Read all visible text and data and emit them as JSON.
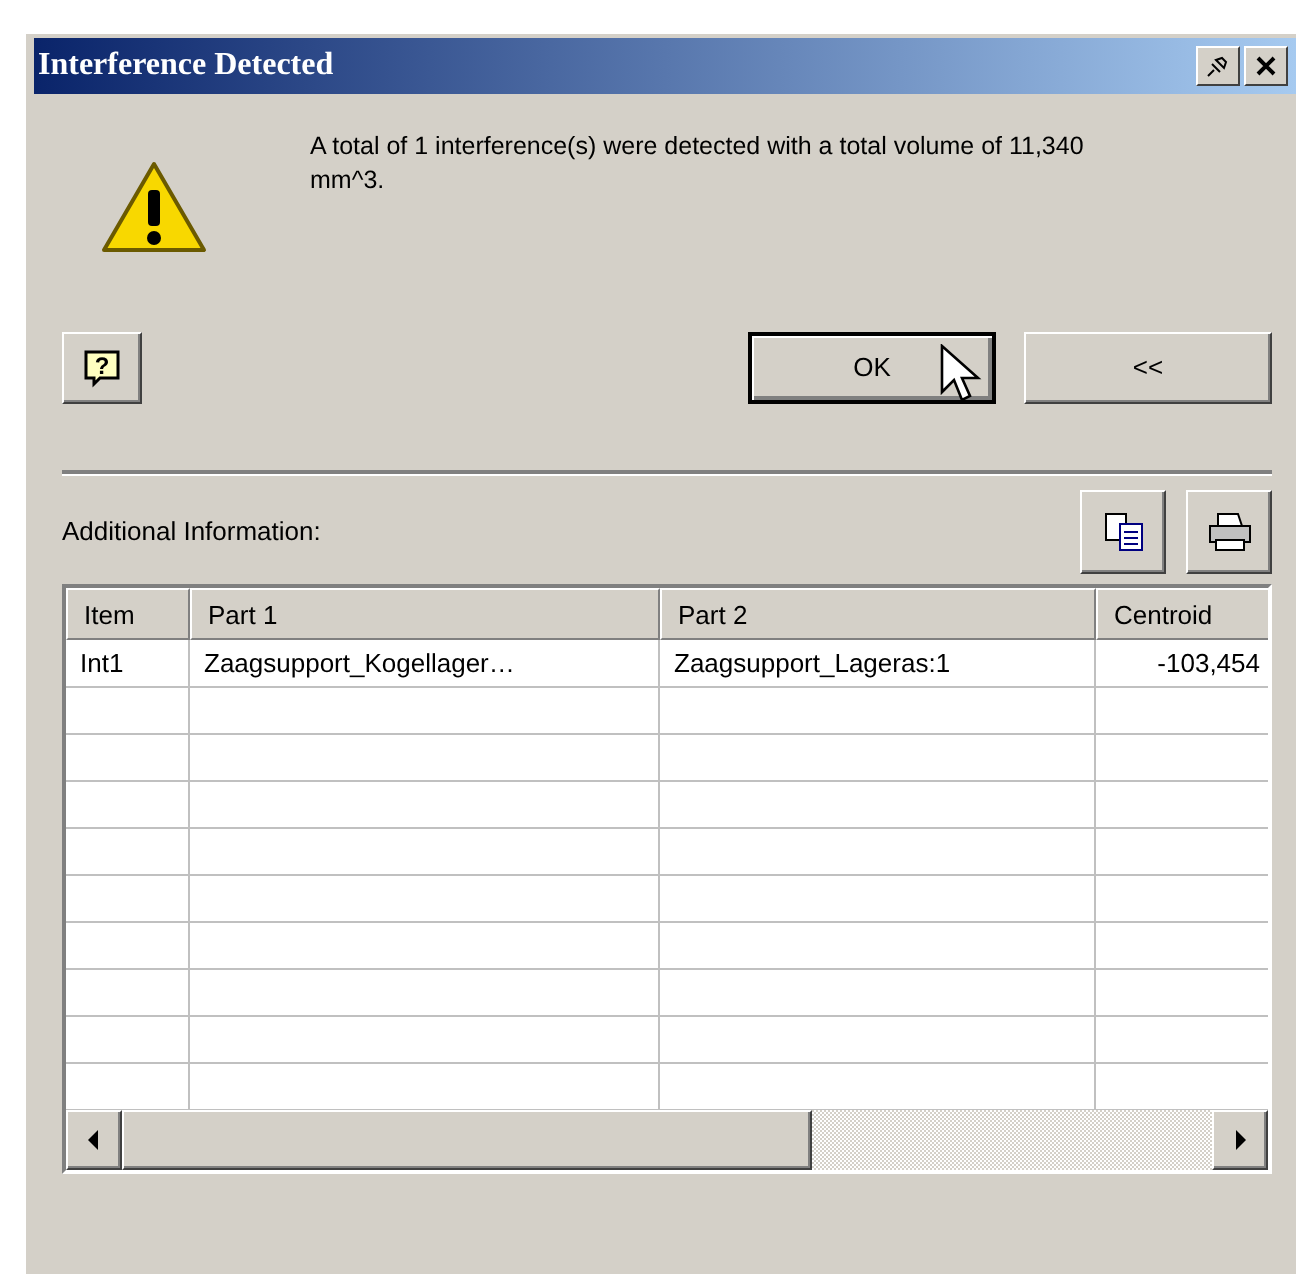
{
  "window": {
    "title": "Interference Detected"
  },
  "message": "A total of 1 interference(s) were detected with a total volume of 11,340 mm^3.",
  "buttons": [
    {
      "label": "OK",
      "kind": "default"
    },
    {
      "label": "<<",
      "kind": "normal"
    }
  ],
  "help_icon": "?",
  "additional_label": "Additional Information:",
  "table": {
    "columns": [
      "Item",
      "Part 1",
      "Part 2",
      "Centroid"
    ],
    "rows": [
      {
        "cells": [
          "Int1",
          "Zaagsupport_Kogellager…",
          "Zaagsupport_Lageras:1",
          "-103,454"
        ]
      }
    ]
  }
}
